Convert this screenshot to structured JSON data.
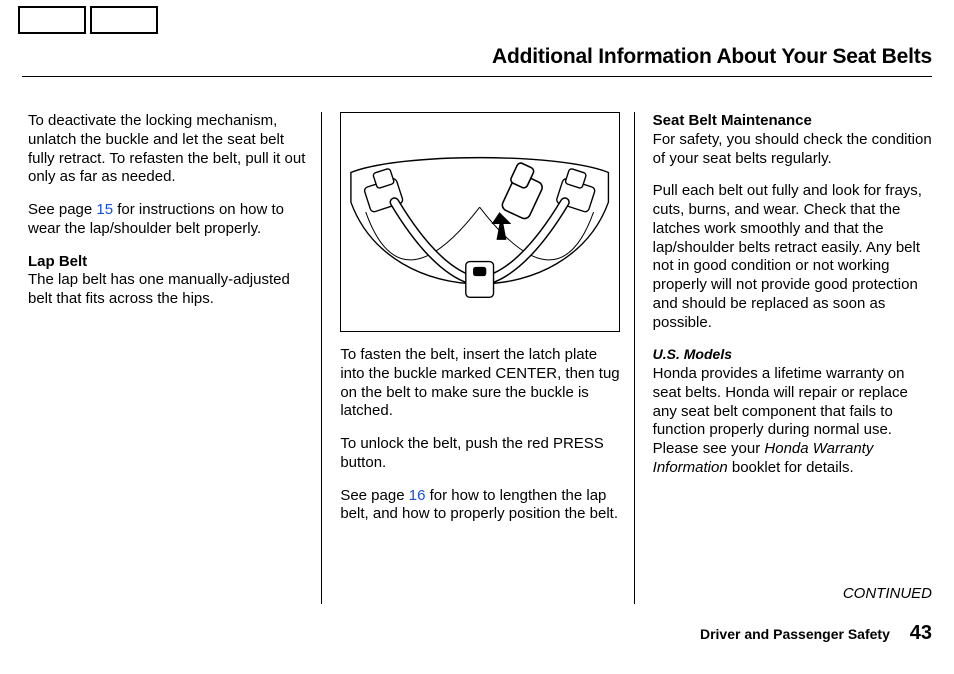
{
  "header": {
    "title": "Additional Information About Your Seat Belts"
  },
  "col1": {
    "p1": "To deactivate the locking mechanism, unlatch the buckle and let the seat belt fully retract. To refasten the belt, pull it out only as far as needed.",
    "p2_a": "See page ",
    "p2_link": "15",
    "p2_b": " for instructions on how to wear the lap/shoulder belt properly.",
    "heading": "Lap Belt",
    "p3": "The lap belt has one manually-adjusted belt that fits across the hips."
  },
  "col2": {
    "p1": "To fasten the belt, insert the latch plate into the buckle marked CENTER, then tug on the belt to make sure the buckle is latched.",
    "p2": "To unlock the belt, push the red PRESS button.",
    "p3_a": "See page ",
    "p3_link": "16",
    "p3_b": " for how to lengthen the lap belt, and how to properly position the belt."
  },
  "col3": {
    "heading": "Seat Belt Maintenance",
    "p1": "For safety, you should check the condition of your seat belts regularly.",
    "p2": "Pull each belt out fully and look for frays, cuts, burns, and wear. Check that the latches work smoothly and that the lap/shoulder belts retract easily. Any belt not in good condition or not working properly will not provide good protection and should be replaced as soon as possible.",
    "sub": "U.S. Models",
    "p3_a": "Honda provides a lifetime warranty on seat belts. Honda will repair or replace any seat belt component that fails to function properly during normal use. Please see your ",
    "p3_ital": "Honda Warranty Information",
    "p3_b": " booklet for details."
  },
  "continued": "CONTINUED",
  "footer": {
    "section": "Driver and Passenger Safety",
    "page": "43"
  }
}
